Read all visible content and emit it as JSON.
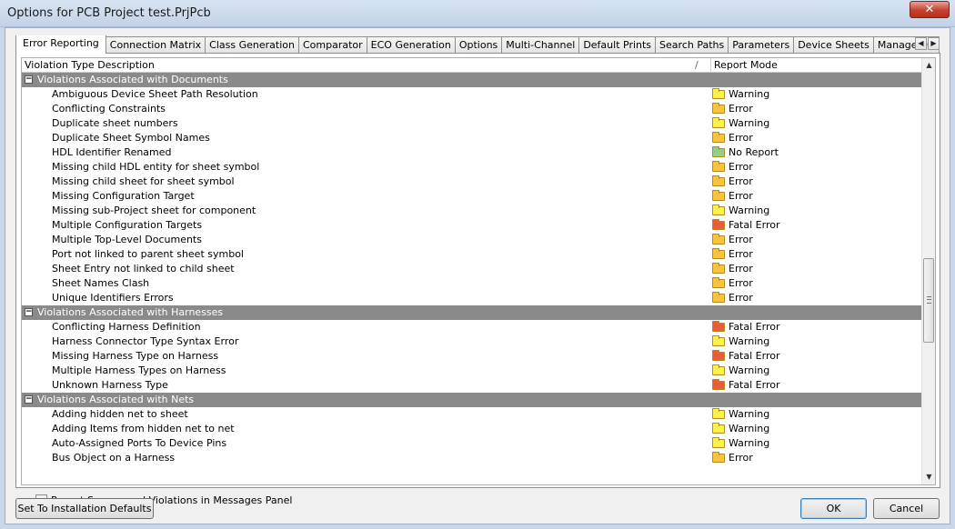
{
  "window": {
    "title": "Options for PCB Project test.PrjPcb",
    "close_label": "✕"
  },
  "tabs": [
    {
      "label": "Error Reporting",
      "active": true
    },
    {
      "label": "Connection Matrix"
    },
    {
      "label": "Class Generation"
    },
    {
      "label": "Comparator"
    },
    {
      "label": "ECO Generation"
    },
    {
      "label": "Options"
    },
    {
      "label": "Multi-Channel"
    },
    {
      "label": "Default Prints"
    },
    {
      "label": "Search Paths"
    },
    {
      "label": "Parameters"
    },
    {
      "label": "Device Sheets"
    },
    {
      "label": "Managed O"
    }
  ],
  "grid": {
    "col_violation": "Violation Type Description",
    "col_sort_glyph": "/",
    "col_report": "Report Mode",
    "groups": [
      {
        "label": "Violations Associated with Documents",
        "toggle": "−",
        "items": [
          {
            "label": "Ambiguous Device Sheet Path Resolution",
            "mode": "Warning"
          },
          {
            "label": "Conflicting Constraints",
            "mode": "Error"
          },
          {
            "label": "Duplicate sheet numbers",
            "mode": "Warning"
          },
          {
            "label": "Duplicate Sheet Symbol Names",
            "mode": "Error"
          },
          {
            "label": "HDL Identifier Renamed",
            "mode": "No Report"
          },
          {
            "label": "Missing child HDL entity for sheet symbol",
            "mode": "Error"
          },
          {
            "label": "Missing child sheet for sheet symbol",
            "mode": "Error"
          },
          {
            "label": "Missing Configuration Target",
            "mode": "Error"
          },
          {
            "label": "Missing sub-Project sheet for component",
            "mode": "Warning"
          },
          {
            "label": "Multiple Configuration Targets",
            "mode": "Fatal Error"
          },
          {
            "label": "Multiple Top-Level Documents",
            "mode": "Error"
          },
          {
            "label": "Port not linked to parent sheet symbol",
            "mode": "Error"
          },
          {
            "label": "Sheet Entry not linked to child sheet",
            "mode": "Error"
          },
          {
            "label": "Sheet Names Clash",
            "mode": "Error"
          },
          {
            "label": "Unique Identifiers Errors",
            "mode": "Error"
          }
        ]
      },
      {
        "label": "Violations Associated with Harnesses",
        "toggle": "−",
        "items": [
          {
            "label": "Conflicting Harness Definition",
            "mode": "Fatal Error"
          },
          {
            "label": "Harness Connector Type Syntax Error",
            "mode": "Warning"
          },
          {
            "label": "Missing Harness Type on Harness",
            "mode": "Fatal Error"
          },
          {
            "label": "Multiple Harness Types on Harness",
            "mode": "Warning"
          },
          {
            "label": "Unknown Harness Type",
            "mode": "Fatal Error"
          }
        ]
      },
      {
        "label": "Violations Associated with Nets",
        "toggle": "−",
        "items": [
          {
            "label": "Adding hidden net to sheet",
            "mode": "Warning"
          },
          {
            "label": "Adding Items from hidden net to net",
            "mode": "Warning"
          },
          {
            "label": "Auto-Assigned Ports To Device Pins",
            "mode": "Warning"
          },
          {
            "label": "Bus Object on a Harness",
            "mode": "Error"
          }
        ]
      }
    ]
  },
  "mode_colors": {
    "Warning": "#fff04a",
    "Error": "#f8c43c",
    "Fatal Error": "#ec5a3c",
    "No Report": "#8fd18a"
  },
  "scroll_arrows": {
    "up": "▲",
    "down": "▼",
    "left": "◀",
    "right": "▶"
  },
  "footer": {
    "checkbox_label": "Report Suppressed Violations in Messages Panel",
    "checkbox_checked": false,
    "defaults_label": "Set To Installation Defaults",
    "ok_label": "OK",
    "cancel_label": "Cancel"
  }
}
